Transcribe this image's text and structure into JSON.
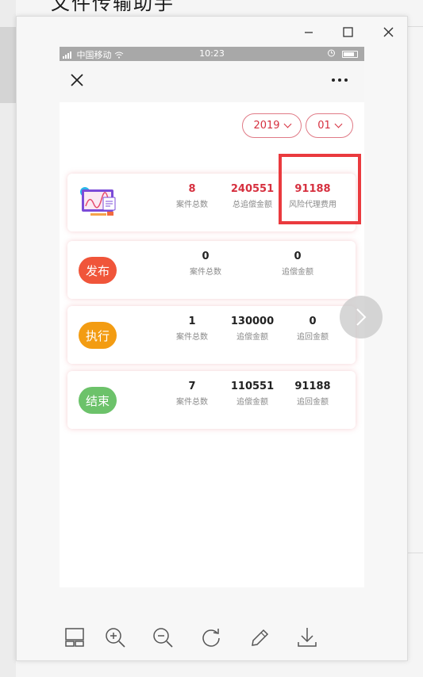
{
  "background": {
    "title": "文件传输助手"
  },
  "status_bar": {
    "carrier": "中国移动",
    "time": "10:23"
  },
  "filters": {
    "year": "2019",
    "month": "01"
  },
  "summary": {
    "stats": [
      {
        "value": "8",
        "label": "案件总数"
      },
      {
        "value": "240551",
        "label": "总追偿金额"
      },
      {
        "value": "91188",
        "label": "风险代理费用"
      }
    ]
  },
  "publish": {
    "badge": "发布",
    "badge_color": "#f0553a",
    "stats": [
      {
        "value": "0",
        "label": "案件总数"
      },
      {
        "value": "0",
        "label": "追偿金额"
      }
    ]
  },
  "execute": {
    "badge": "执行",
    "badge_color": "#f39c12",
    "stats": [
      {
        "value": "1",
        "label": "案件总数"
      },
      {
        "value": "130000",
        "label": "追偿金额"
      },
      {
        "value": "0",
        "label": "追回金额"
      }
    ]
  },
  "finish": {
    "badge": "结束",
    "badge_color": "#6cc26a",
    "stats": [
      {
        "value": "7",
        "label": "案件总数"
      },
      {
        "value": "110551",
        "label": "追偿金额"
      },
      {
        "value": "91188",
        "label": "追回金额"
      }
    ]
  },
  "accent_color": "#d6303f",
  "highlight_color": "#ea3a3e",
  "icons": {
    "window": [
      "minimize-icon",
      "maximize-icon",
      "close-icon"
    ],
    "toolbar": [
      "thumbnail-layout-icon",
      "zoom-in-icon",
      "zoom-out-icon",
      "rotate-icon",
      "edit-pencil-icon",
      "download-icon"
    ],
    "navigation": [
      "chevron-right-icon",
      "close-x-icon",
      "more-dots-icon"
    ]
  }
}
